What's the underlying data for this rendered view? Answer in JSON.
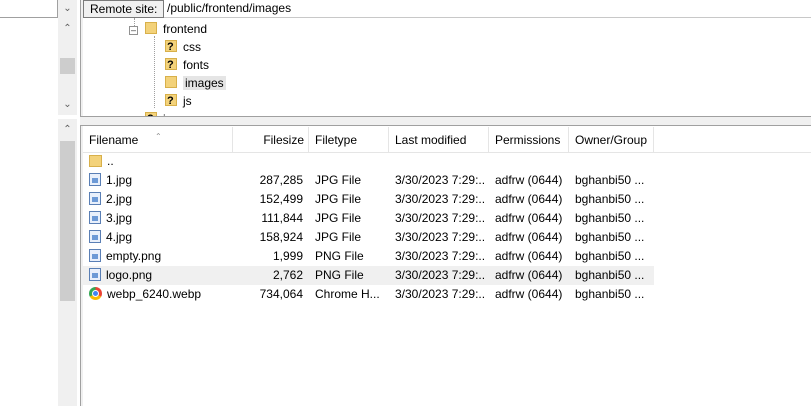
{
  "remote": {
    "label": "Remote site:",
    "path": "/public/frontend/images"
  },
  "tree": {
    "items": [
      {
        "label": "frontend",
        "unknown": false,
        "selected": false
      },
      {
        "label": "css",
        "unknown": true,
        "selected": false
      },
      {
        "label": "fonts",
        "unknown": true,
        "selected": false
      },
      {
        "label": "images",
        "unknown": false,
        "selected": true
      },
      {
        "label": "js",
        "unknown": true,
        "selected": false
      },
      {
        "label": "images",
        "unknown": true,
        "selected": false
      }
    ]
  },
  "columns": {
    "filename": "Filename",
    "filesize": "Filesize",
    "filetype": "Filetype",
    "modified": "Last modified",
    "permissions": "Permissions",
    "owner": "Owner/Group"
  },
  "files": [
    {
      "name": "..",
      "size": "",
      "type": "",
      "modified": "",
      "perm": "",
      "owner": "",
      "icon": "parent-folder-icon"
    },
    {
      "name": "1.jpg",
      "size": "287,285",
      "type": "JPG File",
      "modified": "3/30/2023 7:29:...",
      "perm": "adfrw (0644)",
      "owner": "bghanbi50 ...",
      "icon": "image-file-icon"
    },
    {
      "name": "2.jpg",
      "size": "152,499",
      "type": "JPG File",
      "modified": "3/30/2023 7:29:...",
      "perm": "adfrw (0644)",
      "owner": "bghanbi50 ...",
      "icon": "image-file-icon"
    },
    {
      "name": "3.jpg",
      "size": "111,844",
      "type": "JPG File",
      "modified": "3/30/2023 7:29:...",
      "perm": "adfrw (0644)",
      "owner": "bghanbi50 ...",
      "icon": "image-file-icon"
    },
    {
      "name": "4.jpg",
      "size": "158,924",
      "type": "JPG File",
      "modified": "3/30/2023 7:29:...",
      "perm": "adfrw (0644)",
      "owner": "bghanbi50 ...",
      "icon": "image-file-icon"
    },
    {
      "name": "empty.png",
      "size": "1,999",
      "type": "PNG File",
      "modified": "3/30/2023 7:29:...",
      "perm": "adfrw (0644)",
      "owner": "bghanbi50 ...",
      "icon": "image-file-icon"
    },
    {
      "name": "logo.png",
      "size": "2,762",
      "type": "PNG File",
      "modified": "3/30/2023 7:29:...",
      "perm": "adfrw (0644)",
      "owner": "bghanbi50 ...",
      "icon": "image-file-icon"
    },
    {
      "name": "webp_6240.webp",
      "size": "734,064",
      "type": "Chrome H...",
      "modified": "3/30/2023 7:29:...",
      "perm": "adfrw (0644)",
      "owner": "bghanbi50 ...",
      "icon": "chrome-icon"
    }
  ],
  "colors": {
    "highlight_row": "#f0f0f0",
    "folder": "#f3d27a"
  }
}
